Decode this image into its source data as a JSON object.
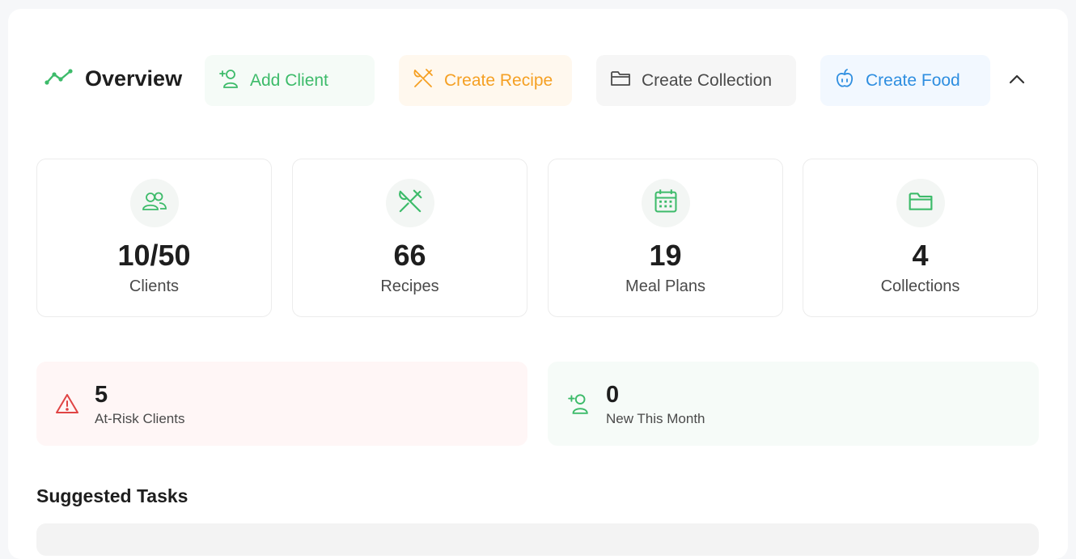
{
  "header": {
    "title": "Overview",
    "title_icon": "trend-line-icon"
  },
  "actions": {
    "add_client": "Add Client",
    "create_recipe": "Create Recipe",
    "create_collection": "Create Collection",
    "create_food": "Create Food"
  },
  "stats": [
    {
      "value": "10/50",
      "label": "Clients",
      "icon": "users-icon"
    },
    {
      "value": "66",
      "label": "Recipes",
      "icon": "utensils-icon"
    },
    {
      "value": "19",
      "label": "Meal Plans",
      "icon": "calendar-icon"
    },
    {
      "value": "4",
      "label": "Collections",
      "icon": "folder-icon"
    }
  ],
  "alerts": {
    "at_risk": {
      "value": "5",
      "label": "At-Risk Clients"
    },
    "new_this_month": {
      "value": "0",
      "label": "New This Month"
    }
  },
  "suggested_tasks": {
    "title": "Suggested Tasks"
  },
  "colors": {
    "green": "#3dbb6a",
    "orange": "#f5a023",
    "gray": "#4a4a4a",
    "blue": "#2e8ee0",
    "red": "#e04444"
  }
}
